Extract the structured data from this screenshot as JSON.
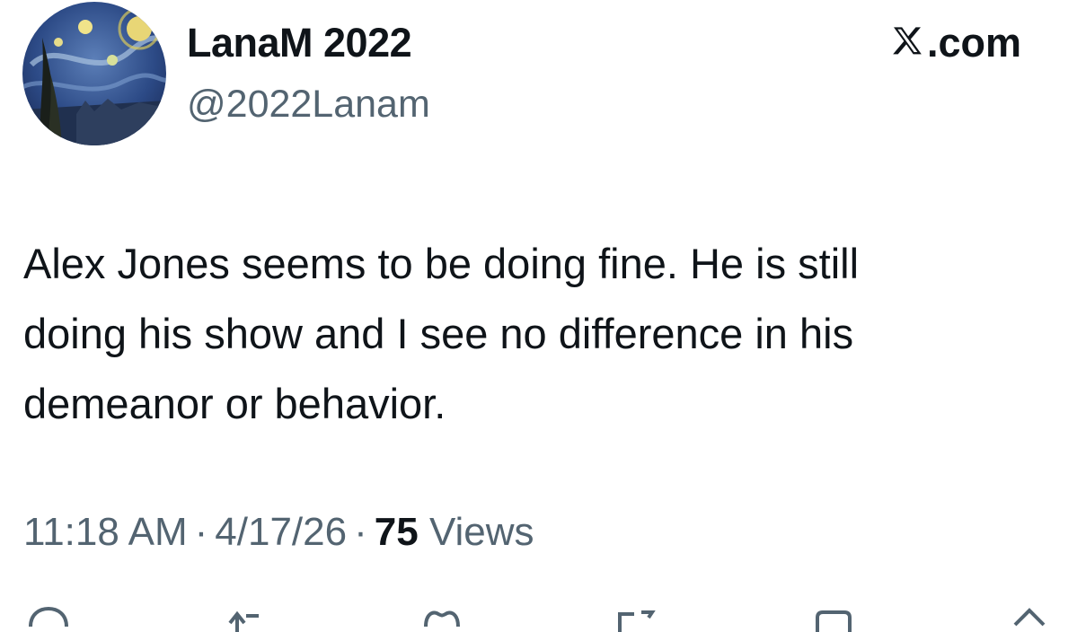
{
  "author": {
    "display_name": "LanaM 2022",
    "handle": "@2022Lanam",
    "avatar_icon": "starry-night-avatar"
  },
  "source": {
    "label": ".com",
    "logo_icon": "x-logo-icon"
  },
  "tweet": {
    "lines": [
      "Alex Jones seems to be doing fine.  He is still",
      "doing his show and I see no difference in his",
      "demeanor or behavior."
    ]
  },
  "meta": {
    "time": "11:18 AM",
    "separator": "·",
    "date": "4/17/26",
    "views_count": "75",
    "views_label": "Views"
  },
  "actions": [
    {
      "icon": "reply-icon"
    },
    {
      "icon": "repost-icon"
    },
    {
      "icon": "like-icon"
    },
    {
      "icon": "bookmark-icon"
    },
    {
      "icon": "share-icon"
    },
    {
      "icon": "upload-icon"
    }
  ],
  "colors": {
    "text_primary": "#0f1419",
    "text_secondary": "#536471",
    "background": "#ffffff"
  }
}
